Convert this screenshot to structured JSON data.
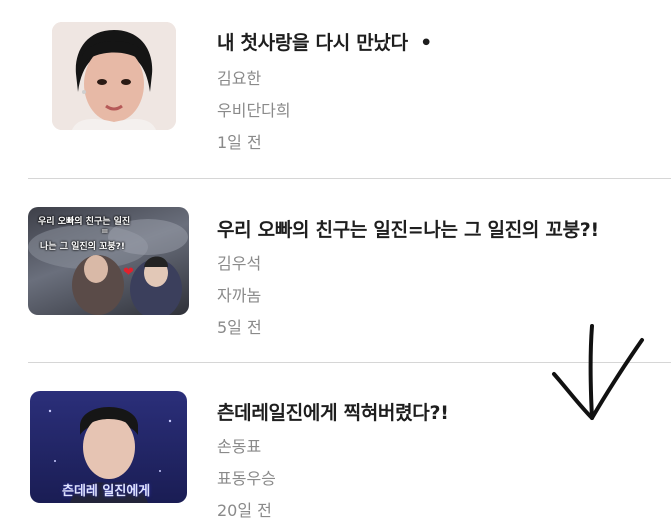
{
  "stories": [
    {
      "title": "내 첫사랑을 다시 만났다",
      "title_marker": "•",
      "author": "김요한",
      "tag": "우비단다희",
      "time": "1일 전",
      "thumb_icon": "portrait-photo"
    },
    {
      "title": "우리 오빠의 친구는 일진=나는 그 일진의 꼬붕?!",
      "author": "김우석",
      "tag": "자까놈",
      "time": "5일 전",
      "thumb_icon": "collage-photo",
      "thumb_text": [
        "우리 오빠의 친구는 일진",
        "=",
        "나는 그 일진의 꼬붕?!"
      ],
      "heart": "❤"
    },
    {
      "title": "츤데레일진에게 찍혀버렸다?!",
      "author": "손동표",
      "tag": "표동우승",
      "time": "20일 전",
      "thumb_icon": "portrait-photo",
      "thumb_text": [
        "츤데레 일진에게"
      ]
    }
  ],
  "annotation": {
    "icon": "hand-drawn-arrow-icon",
    "color": "#111111"
  }
}
